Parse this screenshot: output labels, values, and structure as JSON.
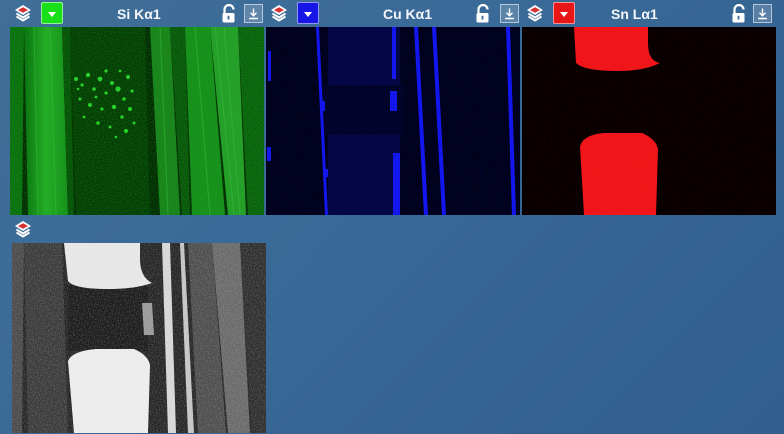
{
  "panels": [
    {
      "title": "Si Kα1",
      "color": "#19e019",
      "icons": {
        "layers": "layers-icon",
        "lock": "unlock-icon",
        "download": "download-icon"
      }
    },
    {
      "title": "Cu Kα1",
      "color": "#1616e8",
      "icons": {
        "layers": "layers-icon",
        "lock": "unlock-icon",
        "download": "download-icon"
      }
    },
    {
      "title": "Sn Lα1",
      "color": "#e81616",
      "icons": {
        "layers": "layers-icon",
        "lock": "unlock-icon",
        "download": "download-icon"
      }
    }
  ],
  "composite": {
    "icons": {
      "layers": "layers-icon"
    }
  }
}
